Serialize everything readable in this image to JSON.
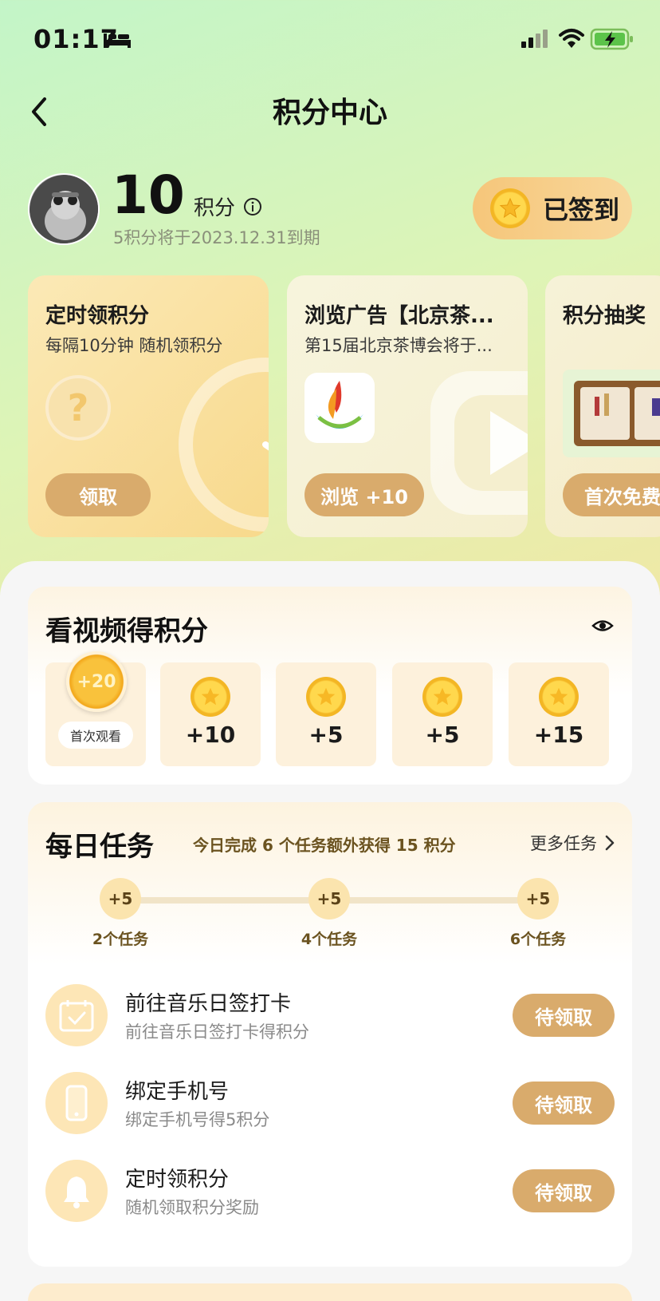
{
  "status_bar": {
    "time": "01:17"
  },
  "nav": {
    "title": "积分中心"
  },
  "profile": {
    "points": "10",
    "points_unit": "积分",
    "expire_note": "5积分将于2023.12.31到期",
    "signin_label": "已签到"
  },
  "promo_cards": [
    {
      "title": "定时领积分",
      "subtitle": "每隔10分钟 随机领积分",
      "button": "领取",
      "icon_text": "?"
    },
    {
      "title": "浏览广告【北京茶...",
      "subtitle": "第15届北京茶博会将于...",
      "button": "浏览 +10"
    },
    {
      "title": "积分抽奖",
      "button": "首次免费"
    }
  ],
  "video_section": {
    "title": "看视频得积分",
    "first": {
      "coin": "+20",
      "label": "首次观看"
    },
    "items": [
      {
        "value": "+10"
      },
      {
        "value": "+5"
      },
      {
        "value": "+5"
      },
      {
        "value": "+15"
      }
    ]
  },
  "tasks_section": {
    "title": "每日任务",
    "bonus_note": "今日完成 6 个任务额外获得 15 积分",
    "more_label": "更多任务",
    "milestones": [
      {
        "badge": "+5",
        "label": "2个任务"
      },
      {
        "badge": "+5",
        "label": "4个任务"
      },
      {
        "badge": "+5",
        "label": "6个任务"
      }
    ],
    "tasks": [
      {
        "name": "前往音乐日签打卡",
        "desc": "前往音乐日签打卡得积分",
        "button": "待领取",
        "icon": "calendar-check-icon"
      },
      {
        "name": "绑定手机号",
        "desc": "绑定手机号得5积分",
        "button": "待领取",
        "icon": "phone-icon"
      },
      {
        "name": "定时领积分",
        "desc": "随机领取积分奖励",
        "button": "待领取",
        "icon": "bell-icon"
      }
    ]
  },
  "colors": {
    "accent": "#d9ab6c",
    "coin": "#ffd84d"
  }
}
